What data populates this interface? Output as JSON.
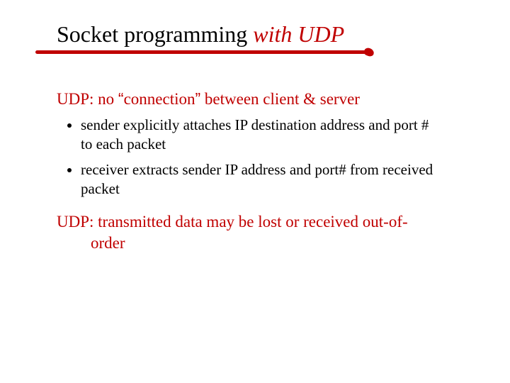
{
  "title": {
    "part1": "Socket programming ",
    "part2": "with UDP"
  },
  "heading1": {
    "pre": "UDP: no ",
    "q1": "“",
    "mid": "connection",
    "q2": "”",
    "post": " between client & server"
  },
  "bullets": [
    "sender explicitly attaches IP destination address and port # to each packet",
    "receiver extracts sender IP address and port# from received packet"
  ],
  "heading2": "UDP: transmitted data may be lost or received out-of-order"
}
